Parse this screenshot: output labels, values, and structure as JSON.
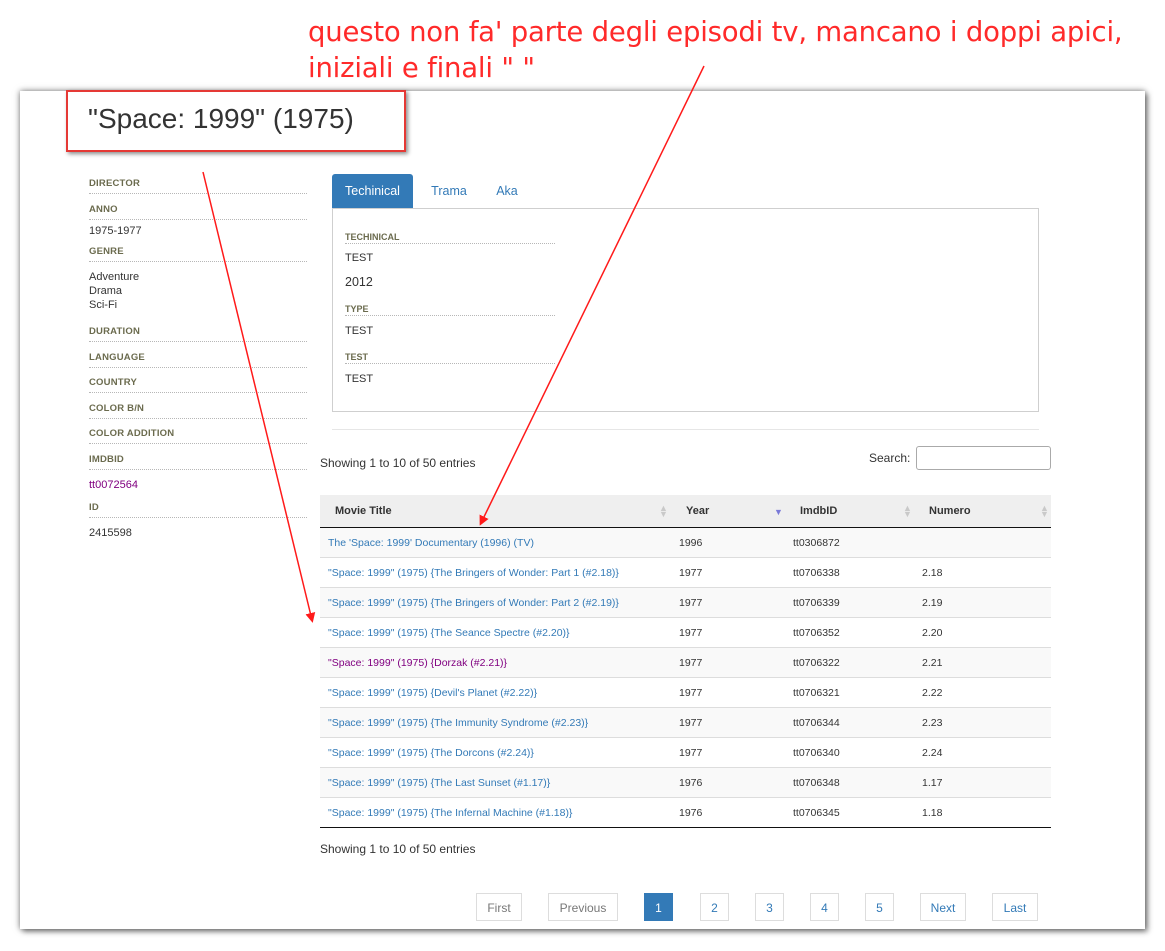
{
  "annotation": {
    "line1": "questo non fa' parte degli episodi tv, mancano i doppi apici,",
    "line2": "iniziali e finali \"   \""
  },
  "page_title": "\"Space: 1999\" (1975)",
  "info": {
    "director_label": "DIRECTOR",
    "anno_label": "ANNO",
    "anno_value": "1975-1977",
    "genre_label": "GENRE",
    "genres": [
      "Adventure",
      "Drama",
      "Sci-Fi"
    ],
    "duration_label": "DURATION",
    "language_label": "LANGUAGE",
    "country_label": "COUNTRY",
    "color_label": "COLOR B/N",
    "color_addition_label": "COLOR ADDITION",
    "imdbid_label": "IMDBID",
    "imdbid_value": "tt0072564",
    "id_label": "ID",
    "id_value": "2415598"
  },
  "tabs": [
    {
      "label": "Techinical",
      "active": true
    },
    {
      "label": "Trama",
      "active": false
    },
    {
      "label": "Aka",
      "active": false
    }
  ],
  "technical_panel": {
    "techinical_label": "TECHINICAL",
    "techinical_value": "TEST",
    "year_value": "2012",
    "type_label": "TYPE",
    "type_value": "TEST",
    "test_label": "TEST",
    "test_value": "TEST"
  },
  "table": {
    "info_top": "Showing 1 to 10 of 50 entries",
    "info_bottom": "Showing 1 to 10 of 50 entries",
    "search_label": "Search:",
    "search_value": "",
    "columns": [
      "Movie Title",
      "Year",
      "ImdbID",
      "Numero"
    ],
    "rows": [
      {
        "title": "The 'Space: 1999' Documentary (1996) (TV)",
        "year": "1996",
        "imdbid": "tt0306872",
        "numero": "",
        "visited": false
      },
      {
        "title": "\"Space: 1999\" (1975) {The Bringers of Wonder: Part 1 (#2.18)}",
        "year": "1977",
        "imdbid": "tt0706338",
        "numero": "2.18",
        "visited": false
      },
      {
        "title": "\"Space: 1999\" (1975) {The Bringers of Wonder: Part 2 (#2.19)}",
        "year": "1977",
        "imdbid": "tt0706339",
        "numero": "2.19",
        "visited": false
      },
      {
        "title": "\"Space: 1999\" (1975) {The Seance Spectre (#2.20)}",
        "year": "1977",
        "imdbid": "tt0706352",
        "numero": "2.20",
        "visited": false
      },
      {
        "title": "\"Space: 1999\" (1975) {Dorzak (#2.21)}",
        "year": "1977",
        "imdbid": "tt0706322",
        "numero": "2.21",
        "visited": true
      },
      {
        "title": "\"Space: 1999\" (1975) {Devil's Planet (#2.22)}",
        "year": "1977",
        "imdbid": "tt0706321",
        "numero": "2.22",
        "visited": false
      },
      {
        "title": "\"Space: 1999\" (1975) {The Immunity Syndrome (#2.23)}",
        "year": "1977",
        "imdbid": "tt0706344",
        "numero": "2.23",
        "visited": false
      },
      {
        "title": "\"Space: 1999\" (1975) {The Dorcons (#2.24)}",
        "year": "1977",
        "imdbid": "tt0706340",
        "numero": "2.24",
        "visited": false
      },
      {
        "title": "\"Space: 1999\" (1975) {The Last Sunset (#1.17)}",
        "year": "1976",
        "imdbid": "tt0706348",
        "numero": "1.17",
        "visited": false
      },
      {
        "title": "\"Space: 1999\" (1975) {The Infernal Machine (#1.18)}",
        "year": "1976",
        "imdbid": "tt0706345",
        "numero": "1.18",
        "visited": false
      }
    ]
  },
  "pagination": {
    "first": "First",
    "previous": "Previous",
    "pages": [
      "1",
      "2",
      "3",
      "4",
      "5"
    ],
    "current": "1",
    "next": "Next",
    "last": "Last"
  },
  "colors": {
    "annotation_red": "#ff2a2a",
    "link_blue": "#337ab7",
    "visited_purple": "#800080",
    "active_tab": "#337ab7"
  }
}
